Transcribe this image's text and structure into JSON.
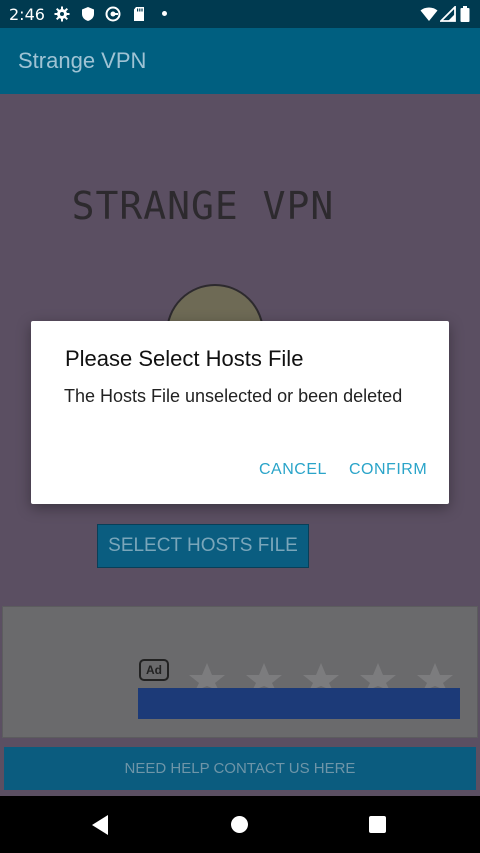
{
  "status_bar": {
    "time": "2:46",
    "icons": [
      "settings-icon",
      "shield-icon",
      "vpn-key-icon",
      "sd-card-icon",
      "notification-dot-icon",
      "wifi-icon",
      "cell-signal-icon",
      "battery-icon"
    ]
  },
  "app_bar": {
    "title": "Strange VPN"
  },
  "main": {
    "brand_title": "STRANGE VPN",
    "select_hosts_label": "SELECT HOSTS FILE"
  },
  "ad": {
    "badge": "Ad",
    "rating_stars": 5
  },
  "help_label": "NEED HELP CONTACT US HERE",
  "dialog": {
    "title": "Please Select Hosts File",
    "message": "The Hosts File unselected or been deleted",
    "cancel_label": "CANCEL",
    "confirm_label": "CONFIRM"
  },
  "colors": {
    "app_bar": "#005f80",
    "accent": "#2aa4c9",
    "scrim_content": "#5b4f62"
  }
}
